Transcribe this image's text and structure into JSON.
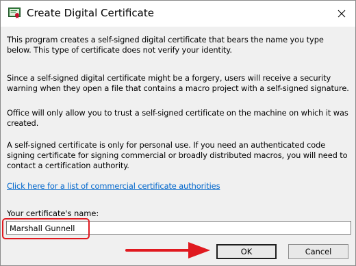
{
  "window": {
    "title": "Create Digital Certificate"
  },
  "body": {
    "paragraphs": [
      "This program creates a self-signed digital certificate that bears the name you type below. This type of certificate does not verify your identity.",
      "Since a self-signed digital certificate might be a forgery, users will receive a security warning when they open a file that contains a macro project with a self-signed signature.",
      "Office will only allow you to trust a self-signed certificate on the machine on which it was created.",
      "A self-signed certificate is only for personal use. If you need an authenticated code signing certificate for signing commercial or broadly distributed macros, you will need to contact a certification authority."
    ],
    "link_text": "Click here for a list of commercial certificate authorities"
  },
  "form": {
    "name_label": "Your certificate's name:",
    "name_value": "Marshall Gunnell"
  },
  "buttons": {
    "ok": "OK",
    "cancel": "Cancel"
  },
  "annotations": {
    "highlight_color": "#e0191f",
    "arrow_color": "#e0191f"
  }
}
